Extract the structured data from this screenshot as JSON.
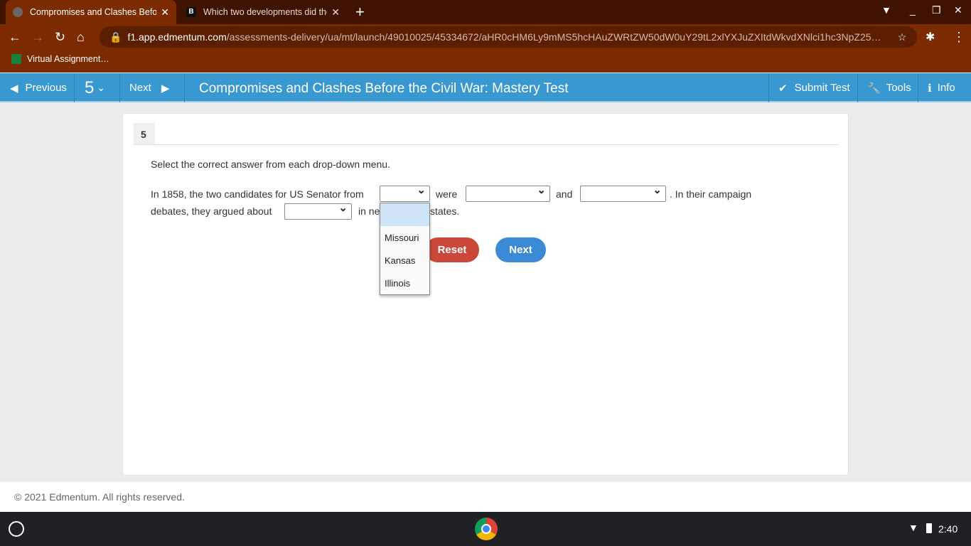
{
  "browser": {
    "tabs": [
      {
        "title": "Compromises and Clashes Befo",
        "active": true
      },
      {
        "title": "Which two developments did the",
        "active": false
      }
    ],
    "url_host": "f1.app.edmentum.com",
    "url_path": "/assessments-delivery/ua/mt/launch/49010025/45334672/aHR0cHM6Ly9mMS5hcHAuZWRtZW50dW0uY29tL2xlYXJuZXItdWkvdXNlci1hc3NpZ25…",
    "bookmark": "Virtual Assignment…"
  },
  "appbar": {
    "previous": "Previous",
    "question_number": "5",
    "next": "Next",
    "title": "Compromises and Clashes Before the Civil War: Mastery Test",
    "submit": "Submit Test",
    "tools": "Tools",
    "info": "Info"
  },
  "question": {
    "number": "5",
    "instruction": "Select the correct answer from each drop-down menu.",
    "part1": "In 1858, the two candidates for US Senator from",
    "part2": "were",
    "part3": "and",
    "part4": ". In their campaign",
    "part5": "debates, they argued about",
    "part6": "in ne",
    "part7": "states.",
    "dropdown_options": [
      "",
      "Missouri",
      "Kansas",
      "Illinois"
    ]
  },
  "buttons": {
    "reset": "Reset",
    "next": "Next"
  },
  "footer": "© 2021 Edmentum. All rights reserved.",
  "shelf": {
    "time": "2:40"
  },
  "colors": {
    "appbar": "#3a98d0",
    "reset": "#c9483a",
    "next": "#3a8ad6",
    "browser": "#7c2a00"
  }
}
